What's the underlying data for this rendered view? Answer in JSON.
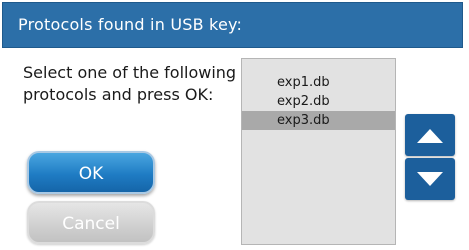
{
  "dialog": {
    "title": "Protocols found in USB key:",
    "instruction": "Select one of the following protocols and press OK:",
    "ok_label": "OK",
    "cancel_label": "Cancel"
  },
  "protocols": {
    "items": [
      {
        "label": "exp1.db",
        "selected": false
      },
      {
        "label": "exp2.db",
        "selected": false
      },
      {
        "label": "exp3.db",
        "selected": true
      }
    ]
  },
  "icons": {
    "scroll_up": "triangle-up-icon",
    "scroll_down": "triangle-down-icon"
  },
  "colors": {
    "title_bar": "#2c6fa8",
    "ok_button": "#1f7cc4",
    "cancel_button_disabled": "#cfcfcf",
    "list_background": "#e2e2e2",
    "selected_item": "#a9a9a9",
    "scroll_buttons": "#1c5f9c"
  }
}
